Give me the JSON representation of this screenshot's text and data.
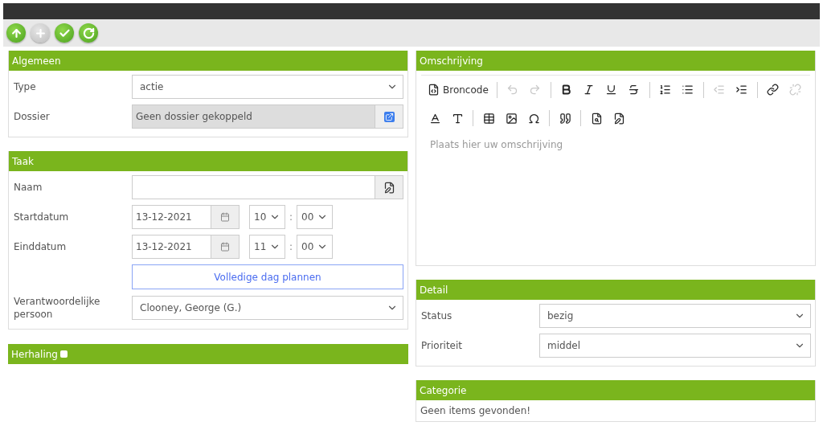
{
  "toolbar": [
    {
      "kind": "upload",
      "disabled": false
    },
    {
      "kind": "add",
      "disabled": true
    },
    {
      "kind": "save",
      "disabled": false
    },
    {
      "kind": "refresh",
      "disabled": false
    }
  ],
  "algemeen": {
    "title": "Algemeen",
    "type": {
      "label": "Type",
      "value": "actie"
    },
    "dossier": {
      "label": "Dossier",
      "value": "Geen dossier gekoppeld"
    }
  },
  "taak": {
    "title": "Taak",
    "naam": {
      "label": "Naam"
    },
    "start": {
      "label": "Startdatum",
      "date": "13-12-2021",
      "hour": "10",
      "separator": ":",
      "minute": "00"
    },
    "end": {
      "label": "Einddatum",
      "date": "13-12-2021",
      "hour": "11",
      "separator": ":",
      "minute": "00"
    },
    "full_day_button": "Volledige dag plannen",
    "person": {
      "label": "Verantwoordelijke persoon",
      "value": "Clooney, George (G.)"
    }
  },
  "herhaling": {
    "title": "Herhaling",
    "checked": false
  },
  "omschrijving": {
    "title": "Omschrijving",
    "editor_toolbar": [
      [
        {
          "kind": "source",
          "label": "Broncode",
          "disabled": false
        },
        {
          "kind": "sep"
        },
        {
          "kind": "undo",
          "disabled": true
        },
        {
          "kind": "redo",
          "disabled": true
        },
        {
          "kind": "sep"
        },
        {
          "kind": "bold",
          "disabled": false
        },
        {
          "kind": "italic",
          "disabled": false
        },
        {
          "kind": "underline",
          "disabled": false
        },
        {
          "kind": "strike",
          "disabled": false
        },
        {
          "kind": "sep"
        },
        {
          "kind": "ol",
          "disabled": false
        },
        {
          "kind": "ul",
          "disabled": false
        },
        {
          "kind": "sep"
        },
        {
          "kind": "outdent",
          "disabled": true
        },
        {
          "kind": "indent",
          "disabled": false
        },
        {
          "kind": "sep"
        },
        {
          "kind": "link",
          "disabled": false
        },
        {
          "kind": "unlink",
          "disabled": true
        }
      ],
      [
        {
          "kind": "textcolor",
          "disabled": false
        },
        {
          "kind": "bgcolor",
          "disabled": false
        },
        {
          "kind": "sep"
        },
        {
          "kind": "table",
          "disabled": false
        },
        {
          "kind": "image",
          "disabled": false
        },
        {
          "kind": "symbol",
          "disabled": false
        },
        {
          "kind": "sep"
        },
        {
          "kind": "quote",
          "disabled": false
        },
        {
          "kind": "sep"
        },
        {
          "kind": "find",
          "disabled": false
        },
        {
          "kind": "template",
          "disabled": false
        }
      ]
    ],
    "placeholder": "Plaats hier uw omschrijving"
  },
  "detail": {
    "title": "Detail",
    "status": {
      "label": "Status",
      "value": "bezig"
    },
    "priority": {
      "label": "Prioriteit",
      "value": "middel"
    }
  },
  "categorie": {
    "title": "Categorie",
    "empty": "Geen items gevonden!"
  }
}
